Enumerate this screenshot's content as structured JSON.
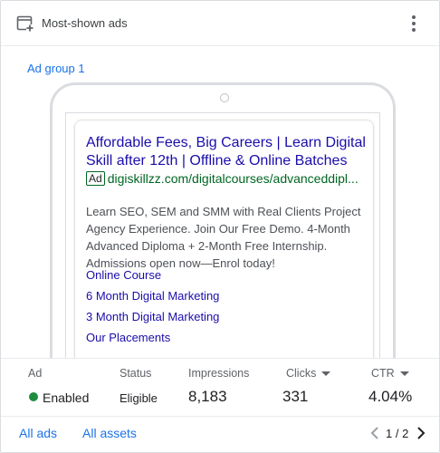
{
  "header": {
    "title": "Most-shown ads",
    "icon": "ad-preview-icon",
    "menu_icon": "more-vert-icon"
  },
  "ad_group_label": "Ad group 1",
  "ad_preview": {
    "headline": "Affordable Fees, Big Careers | Learn Digital Skill after 12th | Offline & Online Batches",
    "badge": "Ad",
    "display_url": "digiskillzz.com/digitalcourses/advanceddipl...",
    "description": "Learn SEO, SEM and SMM with Real Clients Project Agency Experience. Join Our Free Demo. 4-Month Advanced Diploma + 2-Month Free Internship. Admissions open now—Enrol today!",
    "sitelinks": [
      "Online Course",
      "6 Month Digital Marketing",
      "3 Month Digital Marketing",
      "Our Placements"
    ]
  },
  "stats": {
    "labels": {
      "ad": "Ad",
      "status": "Status",
      "impressions": "Impressions",
      "clicks": "Clicks",
      "ctr": "CTR"
    },
    "values": {
      "ad": "Enabled",
      "status": "Eligible",
      "impressions": "8,183",
      "clicks": "331",
      "ctr": "4.04%"
    },
    "status_color": "#1e8e3e"
  },
  "footer": {
    "all_ads": "All ads",
    "all_assets": "All assets",
    "pagination": "1 / 2"
  },
  "colors": {
    "link_blue": "#1a73e8",
    "headline_blue": "#1a0dab",
    "url_green": "#006621"
  }
}
